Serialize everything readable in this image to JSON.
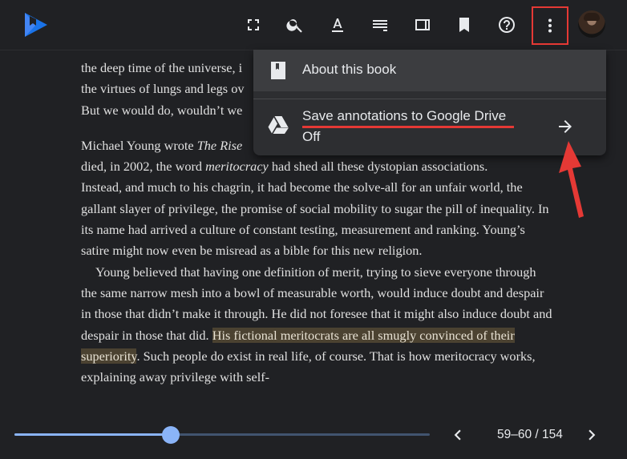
{
  "toolbar": {
    "icons": [
      "fullscreen-icon",
      "search-icon",
      "text-format-icon",
      "contents-icon",
      "side-panel-icon",
      "bookmark-icon",
      "help-icon",
      "more-vert-icon"
    ]
  },
  "book": {
    "lines": [
      "the deep time of the universe, i",
      "the virtues of lungs and legs ov",
      "But we would do, wouldn’t we"
    ],
    "p2_prefix": "Michael Young wrote ",
    "p2_title": "The Rise",
    "p2_line2a": "died, in 2002, the word ",
    "p2_line2em": "meritocracy",
    "p2_line2b": " had shed all these dystopian associations.",
    "p2_rest": "Instead, and much to his chagrin, it had become the solve-all for an unfair world, the gallant slayer of privilege, the promise of social mobility to sugar the pill of inequality. In its name had arrived a culture of constant testing, measurement and ranking. Young’s satire might now even be misread as a bible for this new religion.",
    "p3_text": "Young believed that having one definition of merit, trying to sieve everyone through the same narrow mesh into a bowl of measurable worth, would induce doubt and despair in those that didn’t make it through. He did not foresee that it might also induce doubt and despair in those that did. ",
    "p3_highlight": "His fictional meritocrats are all smugly convinced of their superiority",
    "p3_after": ". Such people do exist in real life, of course. That is how meritocracy works, explaining away privilege with self-"
  },
  "menu": {
    "about_label": "About this book",
    "save_label": "Save annotations to Google Drive",
    "save_status": "Off"
  },
  "footer": {
    "progress": 0.377,
    "page_range": "59–60 / 154"
  },
  "colors": {
    "accent": "#8ab4f8",
    "annotation_red": "#e53935",
    "highlight": "#4b4231"
  }
}
